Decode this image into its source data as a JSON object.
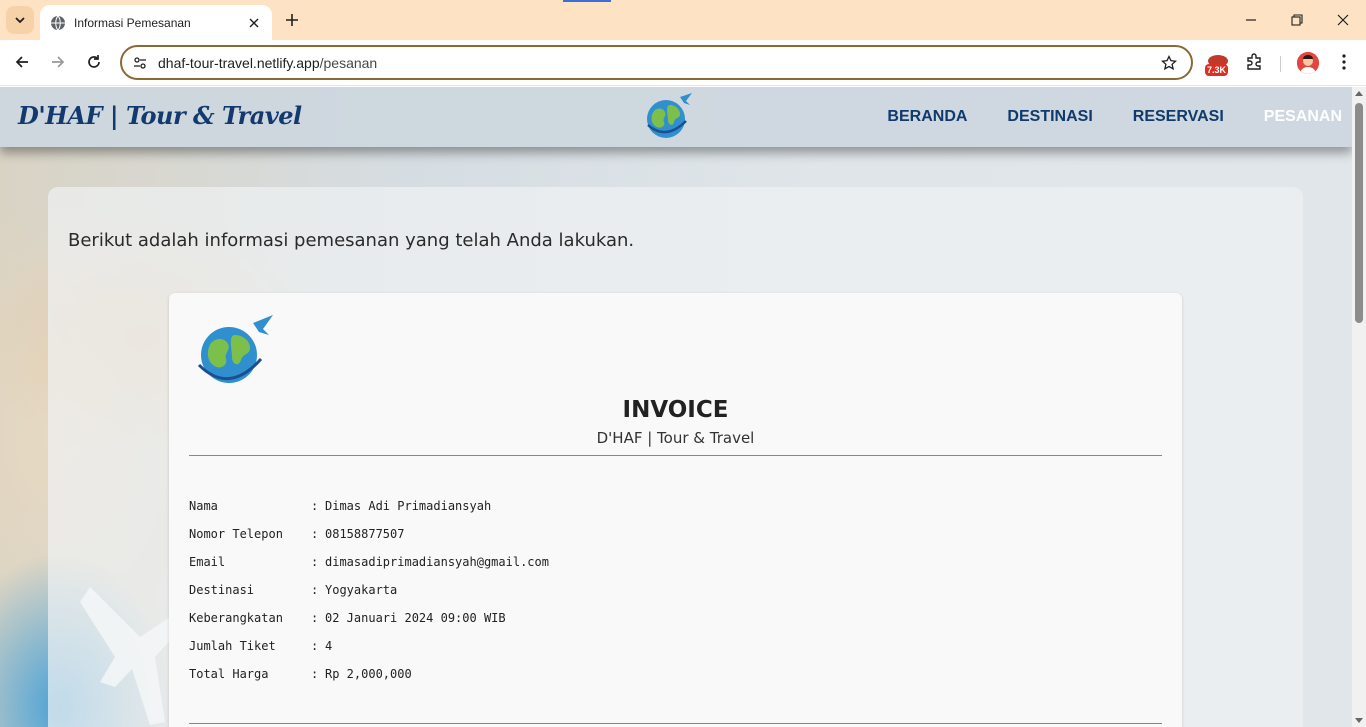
{
  "browser": {
    "tab_title": "Informasi Pemesanan",
    "url_host": "dhaf-tour-travel.netlify.app",
    "url_path": "/pesanan",
    "extension_badge": "7.3K",
    "icons": [
      "tab-search-icon",
      "globe-icon",
      "close-icon",
      "plus-icon",
      "minimize-icon",
      "restore-icon",
      "back-icon",
      "forward-icon",
      "reload-icon",
      "site-settings-icon",
      "star-icon",
      "puzzle-icon",
      "kebab-menu-icon"
    ]
  },
  "header": {
    "brand": "D'HAF | Tour & Travel",
    "nav": [
      "BERANDA",
      "DESTINASI",
      "RESERVASI",
      "PESANAN"
    ],
    "active_nav": "PESANAN"
  },
  "main": {
    "intro": "Berikut adalah informasi pemesanan yang telah Anda lakukan.",
    "invoice": {
      "logo_text": "D'HAF TOUR AND TRAVEL",
      "title": "INVOICE",
      "subtitle": "D'HAF | Tour & Travel",
      "rows": [
        {
          "label": "Nama",
          "value": "Dimas Adi Primadiansyah"
        },
        {
          "label": "Nomor Telepon",
          "value": "08158877507"
        },
        {
          "label": "Email",
          "value": "dimasadiprimadiansyah@gmail.com"
        },
        {
          "label": "Destinasi",
          "value": "Yogyakarta"
        },
        {
          "label": "Keberangkatan",
          "value": "02 Januari 2024 09:00 WIB"
        },
        {
          "label": "Jumlah Tiket",
          "value": "4"
        },
        {
          "label": "Total Harga",
          "value": "Rp 2,000,000"
        }
      ],
      "separator": ":"
    }
  },
  "colors": {
    "tabstrip": "#fde3c4",
    "omnibox_border": "#8a6a34",
    "nav_text": "#0f3a6b",
    "nav_active": "#ffffff",
    "brand": "#123a6e"
  }
}
